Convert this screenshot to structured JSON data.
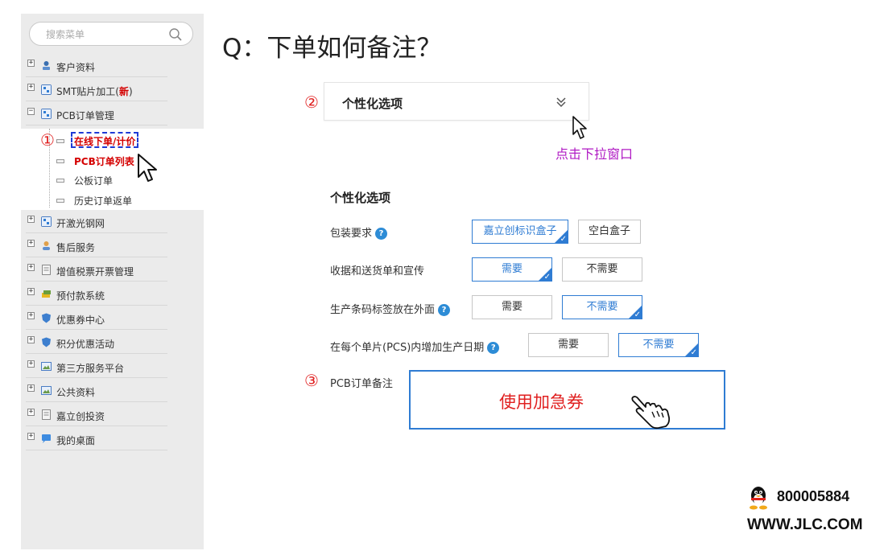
{
  "sidebar": {
    "search_placeholder": "搜索菜单",
    "items": [
      {
        "label": "客户资料"
      },
      {
        "label": "SMT贴片加工(",
        "badge": "新",
        "suffix": ")"
      },
      {
        "label": "PCB订单管理"
      },
      {
        "label": "开激光钢网"
      },
      {
        "label": "售后服务"
      },
      {
        "label": "增值税票开票管理"
      },
      {
        "label": "预付款系统"
      },
      {
        "label": "优惠券中心"
      },
      {
        "label": "积分优惠活动"
      },
      {
        "label": "第三方服务平台"
      },
      {
        "label": "公共资料"
      },
      {
        "label": "嘉立创投资"
      },
      {
        "label": "我的桌面"
      }
    ],
    "pcb_sub": [
      {
        "label": "在线下单/计价"
      },
      {
        "label": "PCB订单列表"
      },
      {
        "label": "公板订单"
      },
      {
        "label": "历史订单返单"
      }
    ]
  },
  "main": {
    "title": "Q：下单如何备注？",
    "step1": "①",
    "step2": "②",
    "step3": "③",
    "dropdown_label": "个性化选项",
    "click_hint": "点击下拉窗口",
    "options_title": "个性化选项",
    "options": [
      {
        "label": "包装要求",
        "help": "?",
        "buttons": [
          "嘉立创标识盒子",
          "空白盒子"
        ],
        "selected": 0
      },
      {
        "label": "收据和送货单和宣传",
        "buttons": [
          "需要",
          "不需要"
        ],
        "selected": 0
      },
      {
        "label": "生产条码标签放在外面",
        "help": "?",
        "buttons": [
          "需要",
          "不需要"
        ],
        "selected": 1
      },
      {
        "label": "在每个单片(PCS)内增加生产日期",
        "help": "?",
        "buttons": [
          "需要",
          "不需要"
        ],
        "selected": 1
      }
    ],
    "notes_label": "PCB订单备注",
    "notes_value": "使用加急券"
  },
  "footer": {
    "phone": "800005884",
    "website": "WWW.JLC.COM"
  },
  "colors": {
    "accent": "#2f7cd3",
    "highlight_red": "#e02020",
    "hint_purple": "#b01ac4",
    "sidebar_bg": "#ebebeb"
  }
}
